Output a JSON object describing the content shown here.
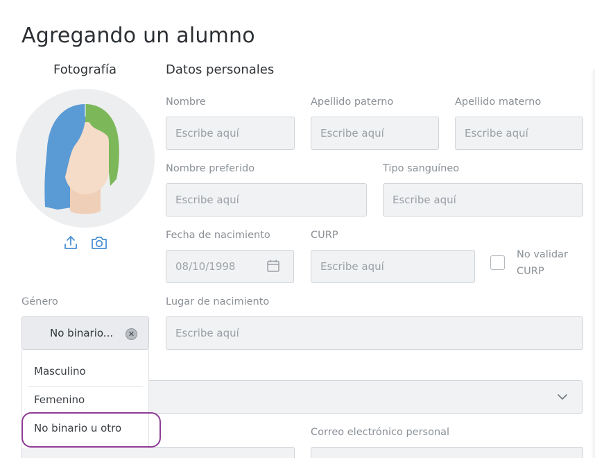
{
  "page": {
    "title": "Agregando un alumno"
  },
  "photo": {
    "title": "Fotografía",
    "upload_icon": "upload-icon",
    "camera_icon": "camera-icon"
  },
  "personal": {
    "title": "Datos personales",
    "nombre": {
      "label": "Nombre",
      "placeholder": "Escribe aquí"
    },
    "apellido_paterno": {
      "label": "Apellido paterno",
      "placeholder": "Escribe aquí"
    },
    "apellido_materno": {
      "label": "Apellido materno",
      "placeholder": "Escribe aquí"
    },
    "nombre_preferido": {
      "label": "Nombre preferido",
      "placeholder": "Escribe aquí"
    },
    "tipo_sanguineo": {
      "label": "Tipo sanguíneo",
      "placeholder": "Escribe aquí"
    },
    "fecha_nacimiento": {
      "label": "Fecha de nacimiento",
      "value": "08/10/1998"
    },
    "curp": {
      "label": "CURP",
      "placeholder": "Escribe aquí"
    },
    "no_validar_curp": {
      "label": "No validar CURP",
      "checked": false
    },
    "lugar_nacimiento": {
      "label": "Lugar de nacimiento",
      "placeholder": "Escribe aquí"
    },
    "correo_personal": {
      "label": "Correo electrónico personal"
    }
  },
  "genero": {
    "label": "Género",
    "selected": "No binario...",
    "options": [
      "Masculino",
      "Femenino",
      "No binario u otro"
    ],
    "highlighted_option": "No binario u otro"
  },
  "colors": {
    "highlight": "#8e3b95",
    "avatar_hair_left": "#5b9bd5",
    "avatar_hair_right": "#7cb85a",
    "avatar_face": "#f5dcc8"
  }
}
